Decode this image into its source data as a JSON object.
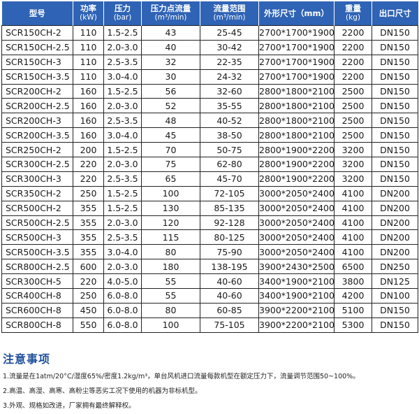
{
  "table": {
    "headers": [
      {
        "main": "型号",
        "sub": ""
      },
      {
        "main": "功率",
        "sub": "(kW)"
      },
      {
        "main": "压力",
        "sub": "(bar)"
      },
      {
        "main": "压力点流量",
        "sub": "(m³/min)"
      },
      {
        "main": "流量范围",
        "sub": "(m³/min)"
      },
      {
        "main": "外形尺寸（mm）",
        "sub": ""
      },
      {
        "main": "重量",
        "sub": "(kg)"
      },
      {
        "main": "出口尺寸",
        "sub": ""
      }
    ],
    "rows": [
      [
        "SCR150CH-2",
        "110",
        "1.5-2.5",
        "43",
        "25-45",
        "2700*1700*1900",
        "2200",
        "DN150"
      ],
      [
        "SCR150CH-2.5",
        "110",
        "2.0-3.0",
        "40",
        "30-42",
        "2700*1700*1900",
        "2200",
        "DN150"
      ],
      [
        "SCR150CH-3",
        "110",
        "2.5-3.5",
        "32",
        "22-35",
        "2700*1700*1900",
        "2200",
        "DN150"
      ],
      [
        "SCR150CH-3.5",
        "110",
        "3.0-4.0",
        "30",
        "24-32",
        "2700*1700*1900",
        "2200",
        "DN150"
      ],
      [
        "SCR200CH-2",
        "160",
        "1.5-2.5",
        "56",
        "32-60",
        "2800*1800*2100",
        "2500",
        "DN150"
      ],
      [
        "SCR200CH-2.5",
        "160",
        "2.0-3.0",
        "52",
        "35-55",
        "2800*1800*2100",
        "2500",
        "DN150"
      ],
      [
        "SCR200CH-3",
        "160",
        "2.5-3.5",
        "48",
        "40-52",
        "2800*1800*2100",
        "2500",
        "DN150"
      ],
      [
        "SCR200CH-3.5",
        "160",
        "3.0-4.0",
        "45",
        "38-50",
        "2800*1800*2100",
        "2500",
        "DN150"
      ],
      [
        "SCR250CH-2",
        "200",
        "1.5-2.5",
        "70",
        "50-75",
        "2800*1900*2200",
        "3200",
        "DN150"
      ],
      [
        "SCR300CH-2.5",
        "220",
        "2.0-3.0",
        "75",
        "62-80",
        "2800*1900*2200",
        "3200",
        "DN150"
      ],
      [
        "SCR300CH-3",
        "220",
        "2.5-3.5",
        "65",
        "45-70",
        "2800*1900*2200",
        "3200",
        "DN150"
      ],
      [
        "SCR350CH-2",
        "250",
        "1.5-2.5",
        "100",
        "72-105",
        "3000*2050*2400",
        "4100",
        "DN200"
      ],
      [
        "SCR500CH-2",
        "355",
        "1.5-2.5",
        "130",
        "85-135",
        "3000*2050*2400",
        "4100",
        "DN200"
      ],
      [
        "SCR500CH-2.5",
        "355",
        "2.0-3.0",
        "120",
        "92-128",
        "3000*2050*2400",
        "4100",
        "DN200"
      ],
      [
        "SCR500CH-3",
        "355",
        "2.5-3.5",
        "115",
        "80-125",
        "3000*2050*2400",
        "4100",
        "DN200"
      ],
      [
        "SCR500CH-3.5",
        "355",
        "3.0-4.0",
        "80",
        "75-90",
        "3000*2050*2400",
        "4100",
        "DN200"
      ],
      [
        "SCR800CH-2.5",
        "600",
        "2.0-3.0",
        "180",
        "138-195",
        "3900*2430*2500",
        "6500",
        "DN250"
      ],
      [
        "SCR300CH-5",
        "220",
        "4.0-5.0",
        "55",
        "40-60",
        "3400*1900*2100",
        "3800",
        "DN125"
      ],
      [
        "SCR400CH-8",
        "250",
        "6.0-8.0",
        "55",
        "40-60",
        "3400*1900*2100",
        "4200",
        "DN100"
      ],
      [
        "SCR600CH-8",
        "450",
        "6.0-8.0",
        "80",
        "60-85",
        "3900*2200*2100",
        "5100",
        "DN150"
      ],
      [
        "SCR800CH-8",
        "550",
        "6.0-8.0",
        "100",
        "75-105",
        "3900*2200*2100",
        "5300",
        "DN150"
      ]
    ]
  },
  "notes": {
    "title": "注意事项",
    "items": [
      "1.流量是在1atm/20°C/湿度65%/密度1.2kg/m³，单台风机进口流量每款机型在额定压力下，流量调节范围50~100%。",
      "2.高温、高湿、高寒、高粉尘等恶劣工况下使用的机器为非标机型。",
      "3.外观、规格如改进，厂家拥有最终解释权。"
    ]
  },
  "colors": {
    "header_bg": "#2f63b5",
    "notes_title": "#1f4f9c"
  }
}
